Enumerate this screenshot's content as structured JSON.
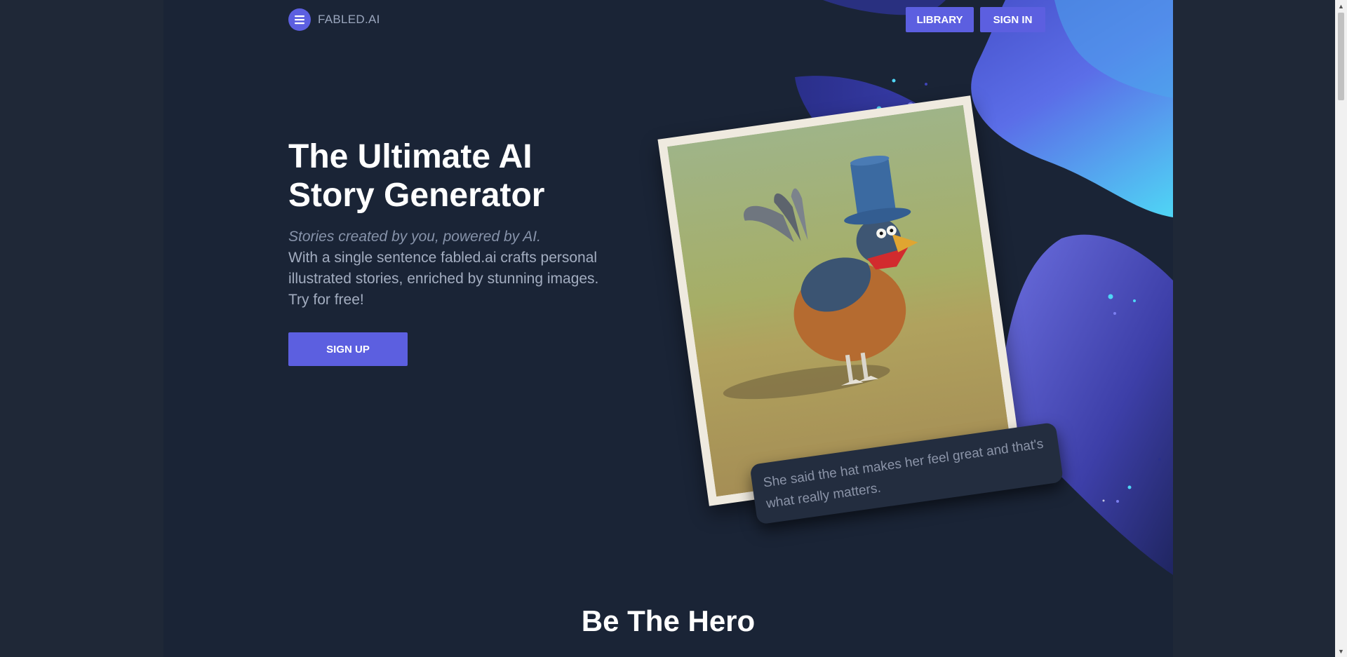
{
  "brand": {
    "name": "FABLED.AI",
    "menu_icon": "hamburger-icon"
  },
  "nav": {
    "library": "LIBRARY",
    "signin": "SIGN IN"
  },
  "hero": {
    "title_line1": "The Ultimate AI",
    "title_line2": "Story Generator",
    "tagline": "Stories created by you, powered by AI.",
    "description": "With a single sentence fabled.ai crafts personal illustrated stories, enriched by stunning images. Try for free!",
    "cta": "SIGN UP"
  },
  "story_card": {
    "image_subject": "watercolor rooster wearing a blue top hat and red bow",
    "caption": "She said the hat makes her feel great and that's what really matters."
  },
  "section": {
    "title": "Be The Hero"
  },
  "colors": {
    "page_bg": "#1a2436",
    "outer_bg": "#1f2837",
    "accent": "#5c5fe0",
    "text_muted": "#8793aa"
  }
}
